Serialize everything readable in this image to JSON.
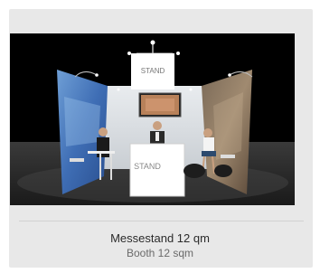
{
  "product": {
    "image_alt": "Messestand 12 qm",
    "stand_logo": "STAND",
    "counter_logo": "STAND",
    "title": "Messestand 12 qm",
    "subtitle": "Booth 12 sqm"
  },
  "colors": {
    "card_background": "#e8e8e8",
    "title_text": "#2b2b2b",
    "subtitle_text": "#6a6a6a"
  }
}
